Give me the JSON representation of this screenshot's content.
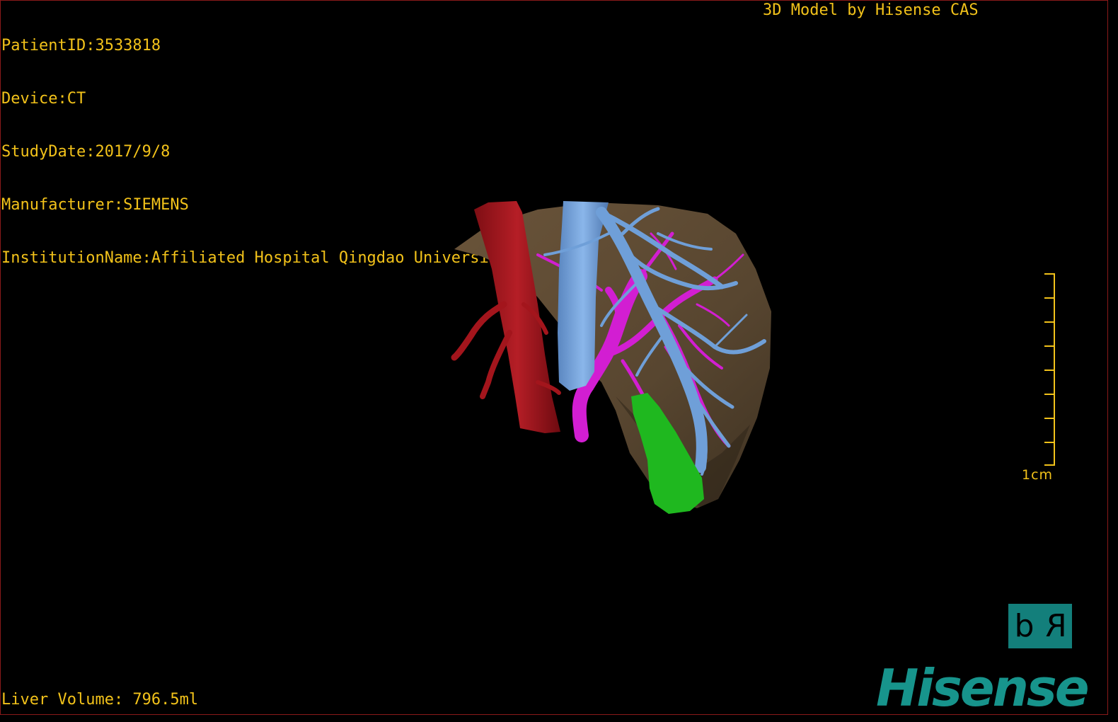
{
  "overlay": {
    "patient_id": "PatientID:3533818",
    "device": "Device:CT",
    "study_date": "StudyDate:2017/9/8",
    "manufacturer": "Manufacturer:SIEMENS",
    "institution": "InstitutionName:Affiliated Hospital Qingdao University-C",
    "model_credit": "3D Model by Hisense CAS",
    "liver_volume": "Liver Volume: 796.5ml"
  },
  "scale_bar": {
    "label": "1cm"
  },
  "orientation_cube": {
    "left_glyph": "d",
    "right_glyph": "R"
  },
  "brand": {
    "logo_text": "Hisense"
  },
  "colors": {
    "overlay_text": "#f2c21a",
    "liver": "#5e4a33",
    "aorta": "#a3151c",
    "vena_cava": "#6f9fd8",
    "portal_vein": "#d21ed2",
    "gallbladder": "#1fb81f",
    "brand": "#17948c",
    "background": "#000000"
  }
}
